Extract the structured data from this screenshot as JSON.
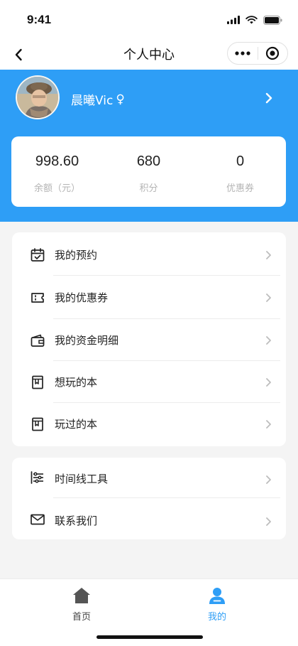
{
  "status_bar": {
    "time": "9:41"
  },
  "nav": {
    "title": "个人中心"
  },
  "profile": {
    "name": "晨曦Vic",
    "gender_symbol": "♀"
  },
  "stats": [
    {
      "value": "998.60",
      "label": "余额（元）"
    },
    {
      "value": "680",
      "label": "积分"
    },
    {
      "value": "0",
      "label": "优惠券"
    }
  ],
  "menu_group_1": [
    {
      "label": "我的预约",
      "icon": "calendar-check-icon"
    },
    {
      "label": "我的优惠券",
      "icon": "ticket-icon"
    },
    {
      "label": "我的资金明细",
      "icon": "wallet-icon"
    },
    {
      "label": "想玩的本",
      "icon": "book-bookmark-icon"
    },
    {
      "label": "玩过的本",
      "icon": "book-bookmark-icon"
    }
  ],
  "menu_group_2": [
    {
      "label": "时间线工具",
      "icon": "sliders-icon"
    },
    {
      "label": "联系我们",
      "icon": "mail-icon"
    }
  ],
  "tabs": [
    {
      "label": "首页",
      "icon": "home-icon",
      "active": false
    },
    {
      "label": "我的",
      "icon": "user-icon",
      "active": true
    }
  ],
  "colors": {
    "primary": "#2e9ef6",
    "tab_inactive": "#555555",
    "text": "#222222",
    "muted": "#b4b4b4",
    "background": "#f4f4f4"
  }
}
